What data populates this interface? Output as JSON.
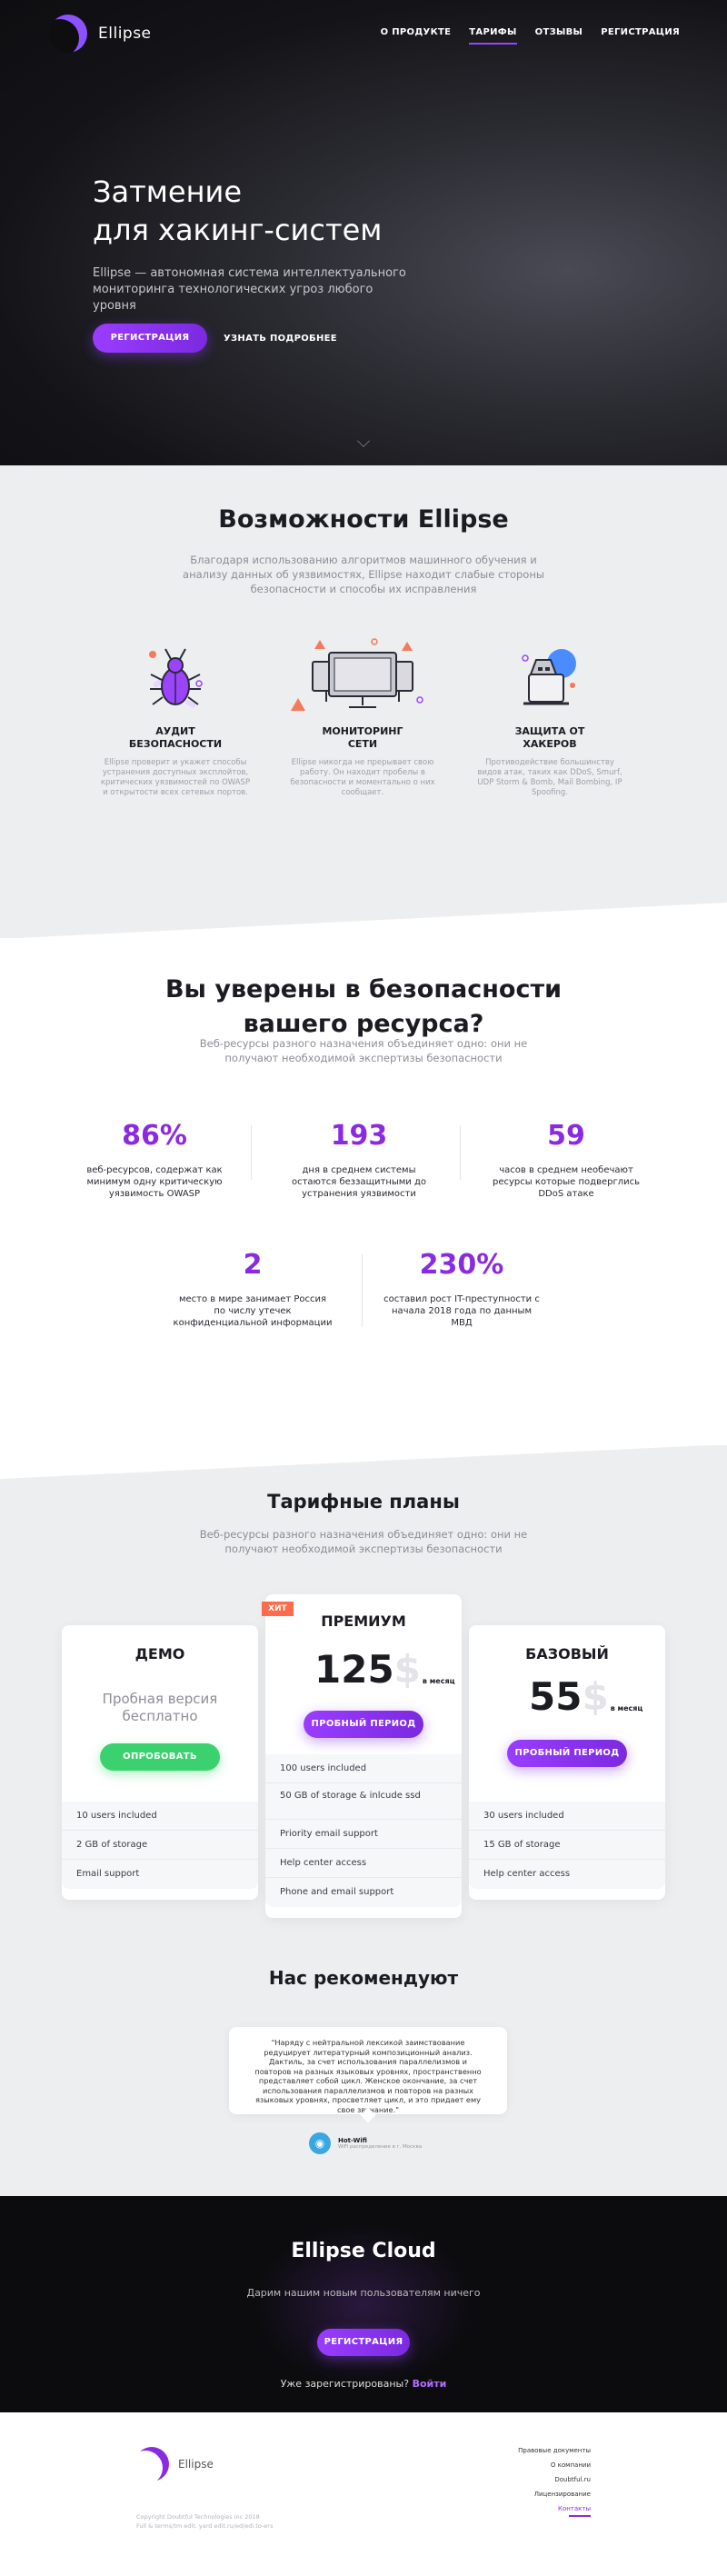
{
  "header": {
    "logo_text": "Ellipse",
    "menu": [
      "О ПРОДУКТЕ",
      "ТАРИФЫ",
      "ОТЗЫВЫ",
      "РЕГИСТРАЦИЯ"
    ]
  },
  "hero": {
    "title_line1": "Затмение",
    "title_line2": "для хакинг-систем",
    "lead": "Ellipse — автономная система интеллектуального мониторинга технологических угроз любого уровня",
    "register_btn": "РЕГИСТРАЦИЯ",
    "more_link": "УЗНАТЬ ПОДРОБНЕЕ"
  },
  "features": {
    "title": "Возможности Ellipse",
    "subtitle": "Благодаря использованию алгоритмов машинного обучения и анализу данных об уязвимостях, Ellipse находит слабые стороны безопасности и способы их исправления",
    "items": [
      {
        "title1": "АУДИТ",
        "title2": "БЕЗОПАСНОСТИ",
        "text": "Ellipse проверит и укажет способы устранения доступных эксплойтов, критических уязвимостей по OWASP и открытости всех сетевых портов."
      },
      {
        "title1": "МОНИТОРИНГ",
        "title2": "СЕТИ",
        "text": "Ellipse никогда не прерывает свою работу. Он находит пробелы в безопасности и моментально о них сообщает."
      },
      {
        "title1": "ЗАЩИТА ОТ",
        "title2": "ХАКЕРОВ",
        "text": "Противодействие большинству видов атак, таких как DDoS, Smurf, UDP Storm & Bomb, Mail Bombing, IP Spoofing."
      }
    ]
  },
  "stats": {
    "title_line1": "Вы уверены в безопасности",
    "title_line2": "вашего ресурса?",
    "subtitle": "Веб-ресурсы разного назначения объединяет одно: они не получают необходимой экспертизы безопасности",
    "items": [
      {
        "num": "86%",
        "label": "веб-ресурсов, содержат как минимум одну критическую уязвимость OWASP"
      },
      {
        "num": "193",
        "label": "дня в среднем системы остаются беззащитными до устранения уязвимости"
      },
      {
        "num": "59",
        "label": "часов в среднем необечают ресурсы которые подверглись DDoS атаке"
      },
      {
        "num": "2",
        "label": "место в мире занимает Россия по числу утечек конфиденциальной информации"
      },
      {
        "num": "230%",
        "label": "составил рост IT-преступности с начала 2018 года по данным МВД"
      }
    ]
  },
  "pricing": {
    "title": "Тарифные планы",
    "subtitle": "Веб-ресурсы разного назначения объединяет одно: они не получают необходимой экспертизы безопасности",
    "demo": {
      "name": "ДЕМО",
      "trial_text": "Пробная версия бесплатно",
      "button": "ОПРОБОВАТЬ",
      "features": [
        "10 users included",
        "2 GB of storage",
        "Email support"
      ]
    },
    "premium": {
      "badge": "ХИТ",
      "name": "ПРЕМИУМ",
      "amount": "125",
      "currency": "$",
      "period": "в месяц",
      "button": "ПРОБНЫЙ ПЕРИОД",
      "features": [
        "100 users included",
        "50 GB of storage & inlcude ssd",
        "Priority email support",
        "Help center access",
        "Phone and email support"
      ]
    },
    "basic": {
      "name": "БАЗОВЫЙ",
      "amount": "55",
      "currency": "$",
      "period": "в месяц",
      "button": "ПРОБНЫЙ ПЕРИОД",
      "features": [
        "30 users included",
        "15 GB of storage",
        "Help center access"
      ]
    }
  },
  "recommend": {
    "title": "Нас рекомендуют",
    "quote": "\"Наряду с нейтральной лексикой заимствование редуцирует литературный композиционный анализ. Дактиль, за счет использования параллелизмов и повторов на разных языковых уровнях, пространственно представляет собой цикл. Женское окончание, за счет использования параллелизмов и повторов на разных языковых уровнях, просветляет цикл, и это придает ему свое звучание.\"",
    "author": "Hot-Wifi",
    "author_sub": "WiFi распределение в г. Москва"
  },
  "cta": {
    "title": "Ellipse Cloud",
    "subtitle": "Дарим нашим новым пользователям ничего",
    "button": "РЕГИСТРАЦИЯ",
    "login_prompt": "Уже зарегистрированы?",
    "login_link": "Войти"
  },
  "footer": {
    "logo_text": "Ellipse",
    "copyright_line1": "Copyright Doubtful Technologies inc 2018",
    "copyright_line2": "Full & terms/tm edit. yard edit.ru/ed/edi.to-ers",
    "links": [
      "Правовые документы",
      "О компании",
      "Doubtful.ru",
      "Лицензирование",
      "Контакты"
    ]
  },
  "colors": {
    "accent": "#8a2be2",
    "green": "#3bd16f",
    "hit": "#ff6b4a"
  }
}
